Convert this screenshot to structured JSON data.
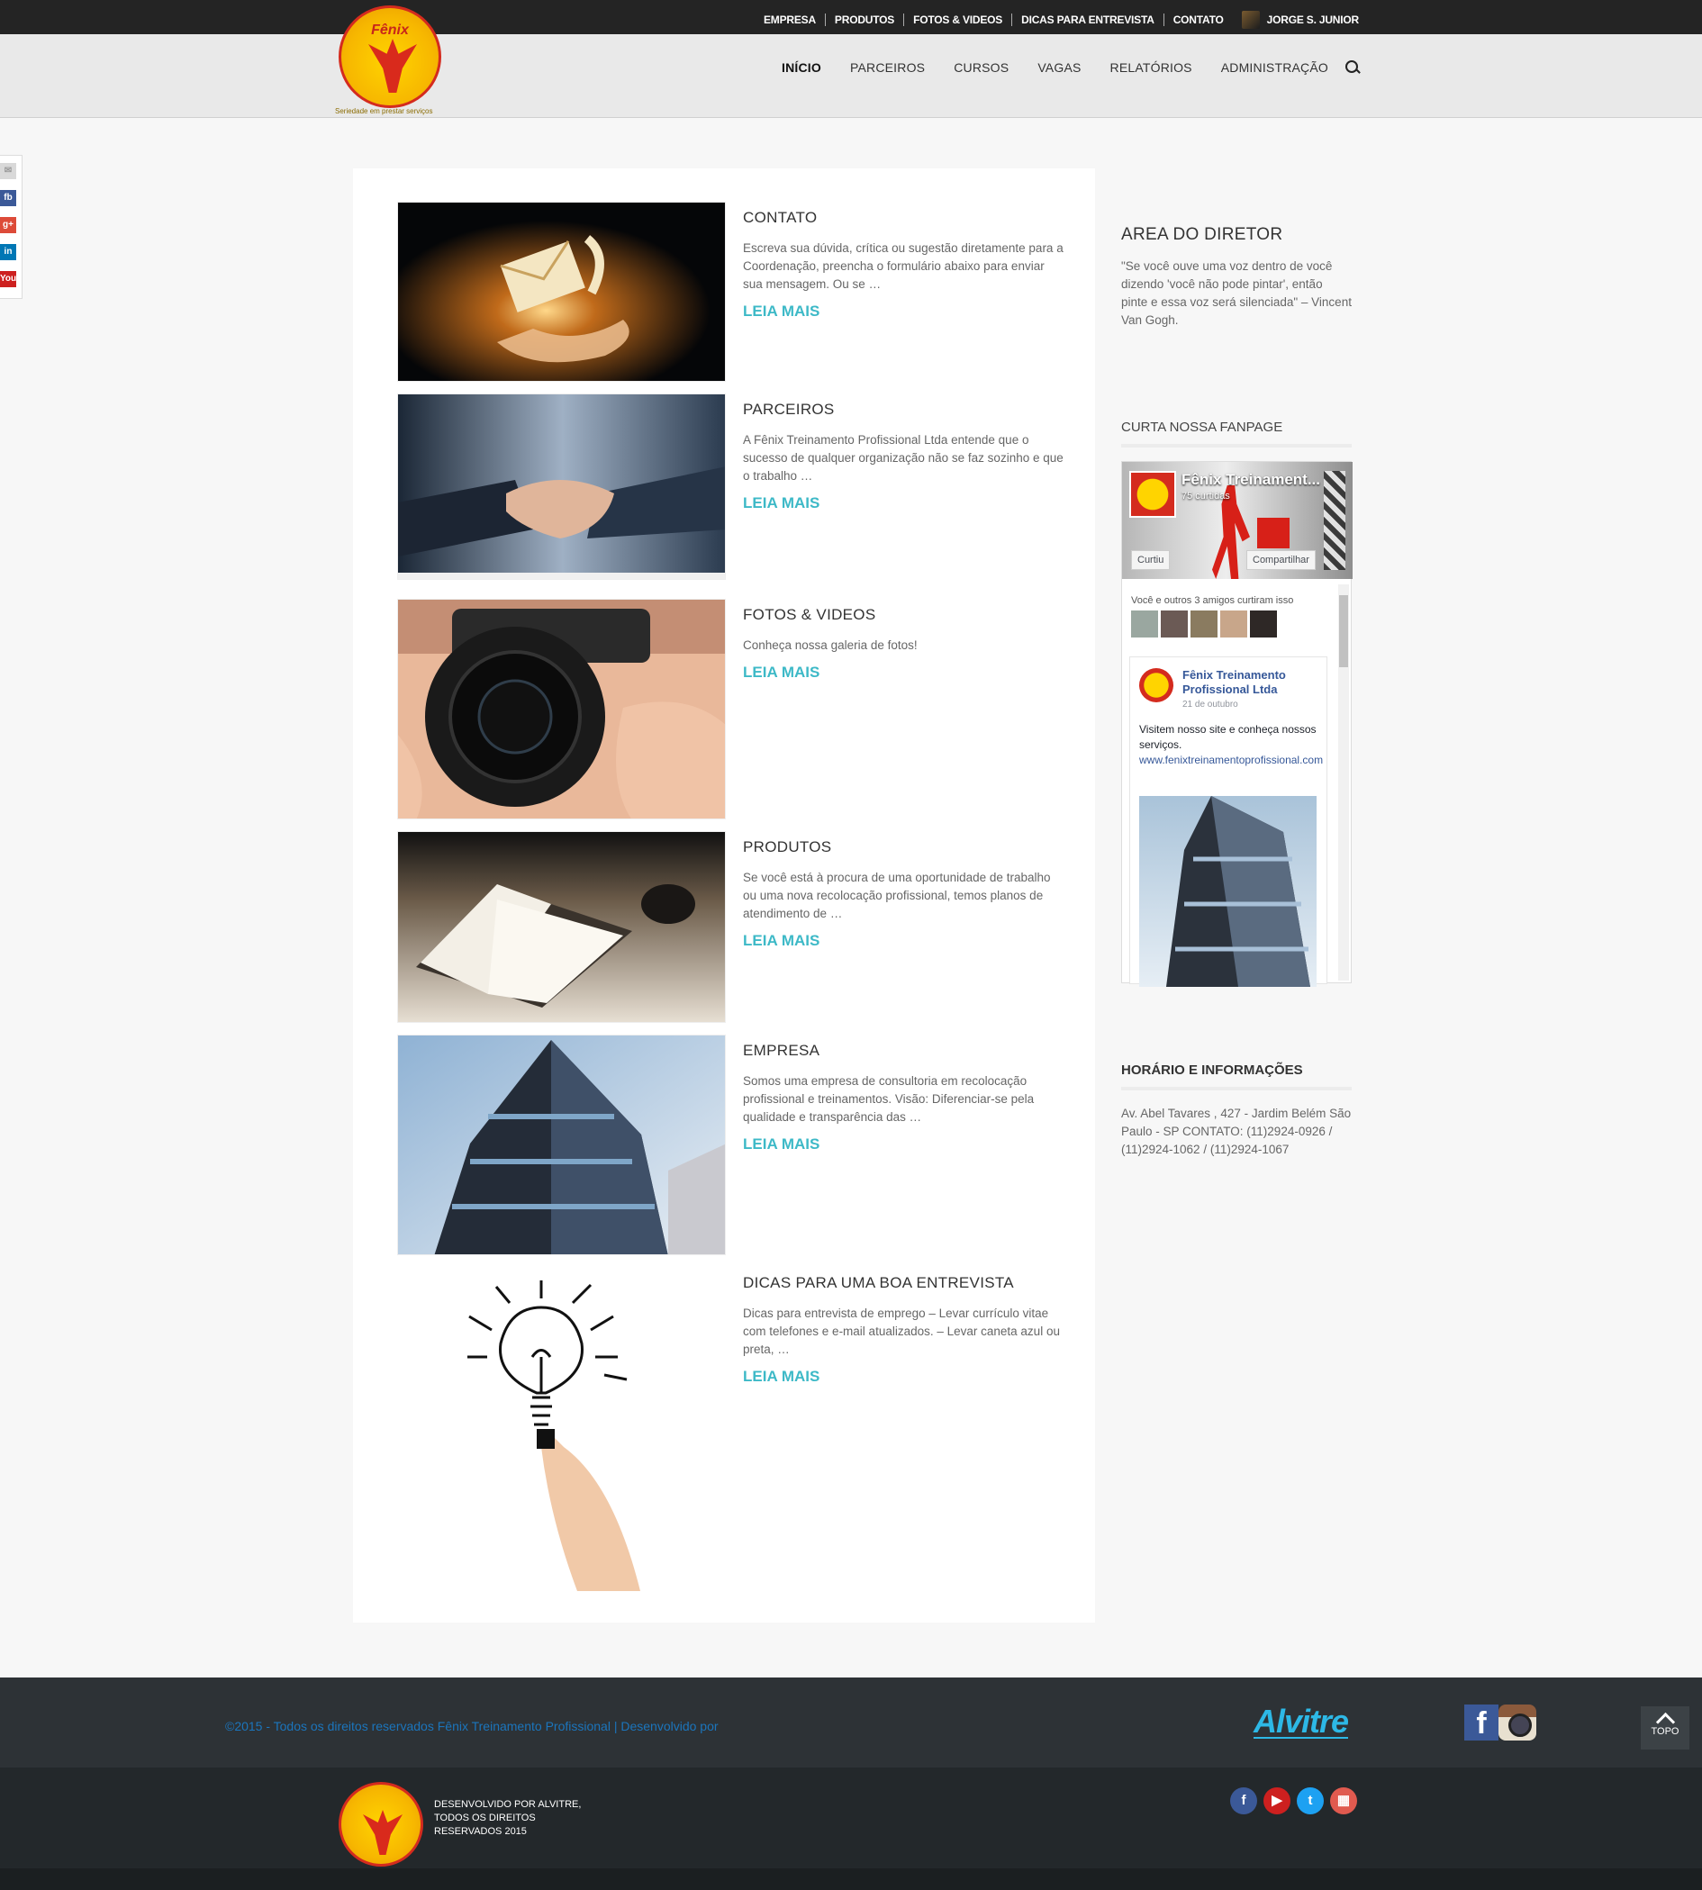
{
  "topbar": {
    "links": [
      "EMPRESA",
      "PRODUTOS",
      "FOTOS & VIDEOS",
      "DICAS PARA ENTREVISTA",
      "CONTATO"
    ],
    "user": "JORGE S. JUNIOR"
  },
  "logo": {
    "name": "Fênix",
    "tagline": "Seriedade em prestar serviços"
  },
  "nav": {
    "items": [
      "INÍCIO",
      "PARCEIROS",
      "CURSOS",
      "VAGAS",
      "RELATÓRIOS",
      "ADMINISTRAÇÃO"
    ],
    "active": "INÍCIO"
  },
  "side_social": {
    "icons": [
      "mail-icon",
      "facebook-icon",
      "google-plus-icon",
      "linkedin-icon",
      "youtube-icon"
    ],
    "labels": [
      "✉",
      "fb",
      "g+",
      "in",
      "You"
    ]
  },
  "posts": [
    {
      "title": "CONTATO",
      "excerpt": "Escreva sua dúvida, crítica ou sugestão diretamente para a Coordenação, preencha o formulário abaixo para enviar sua mensagem. Ou se …",
      "more": "LEIA MAIS"
    },
    {
      "title": "PARCEIROS",
      "excerpt": "A Fênix Treinamento Profissional Ltda entende que o sucesso de qualquer organização não se faz sozinho e que o trabalho …",
      "more": "LEIA MAIS"
    },
    {
      "title": "FOTOS & VIDEOS",
      "excerpt": "Conheça nossa galeria de fotos!",
      "more": "LEIA MAIS"
    },
    {
      "title": "PRODUTOS",
      "excerpt": "Se você está à procura de uma oportunidade de trabalho ou uma nova recolocação profissional, temos planos de atendimento de …",
      "more": "LEIA MAIS"
    },
    {
      "title": "EMPRESA",
      "excerpt": "   Somos uma empresa de consultoria em recolocação profissional e treinamentos.   Visão: Diferenciar-se pela qualidade e transparência das …",
      "more": "LEIA MAIS"
    },
    {
      "title": "DICAS PARA UMA BOA ENTREVISTA",
      "excerpt": "Dicas para entrevista de emprego   – Levar currículo vitae com telefones e e-mail atualizados. – Levar caneta azul ou preta, …",
      "more": "LEIA MAIS"
    }
  ],
  "sidebar": {
    "director_title": "AREA DO DIRETOR",
    "director_quote": "\"Se você ouve uma voz dentro de você dizendo 'você não pode pintar', então pinte e essa voz será silenciada\" – Vincent Van Gogh.",
    "fanpage_title": "CURTA NOSSA FANPAGE",
    "fb": {
      "page_name": "Fênix Treinament...",
      "likes": "75 curtidas",
      "liked_btn": "Curtiu",
      "share_btn": "Compartilhar",
      "friends_text": "Você e outros 3 amigos curtiram isso",
      "post_author": "Fênix Treinamento Profissional Ltda",
      "post_date": "21 de outubro",
      "post_text": "Visitem nosso site e conheça nossos serviços.",
      "post_link": "www.fenixtreinamentoprofissional.com"
    },
    "info_title": "HORÁRIO E INFORMAÇÕES",
    "info_text": "Av. Abel Tavares , 427 - Jardim Belém São Paulo - SP CONTATO: (11)2924-0926 / (11)2924-1062 / (11)2924-1067"
  },
  "footer": {
    "copyright": "©2015 - Todos os direitos reservados Fênix Treinamento Profissional | Desenvolvido por",
    "alvitre": "Alvitre",
    "top_label": "TOPO",
    "dev_text": "DESENVOLVIDO POR ALVITRE, TODOS OS DIREITOS RESERVADOS 2015",
    "socials": [
      "facebook-icon",
      "youtube-icon",
      "twitter-icon",
      "calendar-icon"
    ],
    "social_glyphs": [
      "f",
      "▶",
      "t",
      "▦"
    ],
    "social_colors": [
      "#3b5998",
      "#cd201f",
      "#1da1f2",
      "#e05a4f"
    ]
  }
}
